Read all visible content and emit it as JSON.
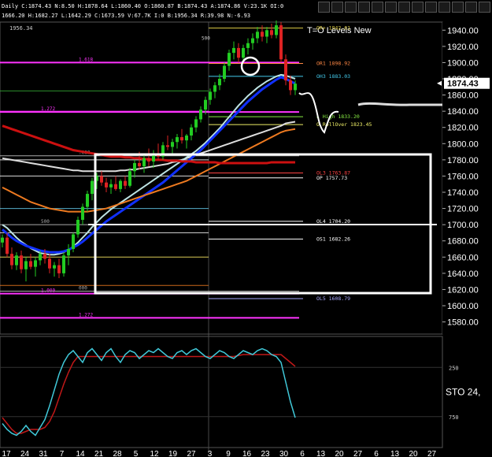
{
  "header": {
    "line1": "Daily  C:1874.43  N:8.50  H:1878.64  L:1860.40  O:1860.87  B:1874.43  A:1874.86  V:23.1K  OI:0",
    "line2": "1666.20  H:1682.27  L:1642.29  C:1673.59  V:67.7K  I:0  B:1956.34  R:39.98  N:-6.93",
    "line3": "1956.34"
  },
  "window_controls": [
    "icon-dollar",
    "icon-expand",
    "icon-pen",
    "icon-crosshair",
    "icon-link",
    "icon-page",
    "icon-calendar",
    "icon-tools",
    "icon-grid",
    "icon-arrows",
    "icon-bars",
    "icon-reset",
    "icon-close"
  ],
  "colors": {
    "background": "#000000",
    "candle_up": "#22cc22",
    "candle_down": "#dd2222",
    "ma_white": "#dddddd",
    "ma_cyan": "#bde3e3",
    "ma_blue": "#1030ff",
    "ma_orange": "#ee7a20",
    "ma_red": "#cc1010",
    "fib_line": "#ff33ff",
    "stoch_k": "#40c8d8",
    "stoch_d": "#c01818",
    "annotation": "#ffffff"
  },
  "chart_data": {
    "type": "candlestick",
    "title": "T=O Levels New",
    "timeframe": "Daily",
    "last_price": "1874.43",
    "ylim": [
      1565,
      1950
    ],
    "y_ticks": [
      1580,
      1600,
      1620,
      1640,
      1660,
      1680,
      1700,
      1720,
      1740,
      1760,
      1780,
      1800,
      1820,
      1840,
      1860,
      1880,
      1900,
      1920,
      1940
    ],
    "y_tick_labels": [
      "1580.00",
      "1600.00",
      "1620.00",
      "1640.00",
      "1660.00",
      "1680.00",
      "1700.00",
      "1720.00",
      "1740.00",
      "1760.00",
      "1780.00",
      "1800.00",
      "1820.00",
      "1840.00",
      "1860.00",
      "1880.00",
      "1900.00",
      "1920.00",
      "1940.00"
    ],
    "x_tick_labels": [
      "17",
      "24",
      "31",
      "7",
      "14",
      "21",
      "28",
      "5",
      "12",
      "19",
      "27",
      "3",
      "9",
      "16",
      "23",
      "30",
      "6",
      "13",
      "20",
      "27",
      "6",
      "13",
      "20",
      "27"
    ],
    "candles": [
      [
        1678,
        1688,
        1672,
        1684
      ],
      [
        1684,
        1690,
        1660,
        1664
      ],
      [
        1664,
        1672,
        1645,
        1650
      ],
      [
        1650,
        1666,
        1644,
        1662
      ],
      [
        1662,
        1668,
        1640,
        1645
      ],
      [
        1645,
        1660,
        1630,
        1655
      ],
      [
        1655,
        1664,
        1645,
        1648
      ],
      [
        1648,
        1660,
        1636,
        1656
      ],
      [
        1656,
        1668,
        1650,
        1664
      ],
      [
        1664,
        1670,
        1652,
        1658
      ],
      [
        1658,
        1664,
        1640,
        1646
      ],
      [
        1646,
        1654,
        1636,
        1650
      ],
      [
        1650,
        1658,
        1634,
        1640
      ],
      [
        1640,
        1666,
        1636,
        1662
      ],
      [
        1662,
        1676,
        1650,
        1670
      ],
      [
        1670,
        1690,
        1666,
        1688
      ],
      [
        1688,
        1710,
        1684,
        1706
      ],
      [
        1706,
        1726,
        1700,
        1722
      ],
      [
        1722,
        1742,
        1716,
        1738
      ],
      [
        1738,
        1758,
        1730,
        1754
      ],
      [
        1754,
        1764,
        1744,
        1760
      ],
      [
        1760,
        1766,
        1748,
        1752
      ],
      [
        1752,
        1758,
        1740,
        1746
      ],
      [
        1746,
        1756,
        1738,
        1750
      ],
      [
        1750,
        1760,
        1742,
        1744
      ],
      [
        1744,
        1756,
        1740,
        1754
      ],
      [
        1754,
        1760,
        1744,
        1748
      ],
      [
        1748,
        1770,
        1746,
        1766
      ],
      [
        1766,
        1780,
        1758,
        1776
      ],
      [
        1776,
        1790,
        1768,
        1772
      ],
      [
        1772,
        1786,
        1764,
        1782
      ],
      [
        1782,
        1794,
        1772,
        1778
      ],
      [
        1778,
        1792,
        1770,
        1788
      ],
      [
        1788,
        1800,
        1780,
        1784
      ],
      [
        1784,
        1802,
        1780,
        1798
      ],
      [
        1798,
        1810,
        1792,
        1796
      ],
      [
        1796,
        1806,
        1786,
        1802
      ],
      [
        1802,
        1812,
        1794,
        1808
      ],
      [
        1808,
        1818,
        1800,
        1804
      ],
      [
        1804,
        1812,
        1794,
        1810
      ],
      [
        1810,
        1824,
        1804,
        1820
      ],
      [
        1820,
        1834,
        1814,
        1830
      ],
      [
        1830,
        1846,
        1826,
        1842
      ],
      [
        1842,
        1858,
        1836,
        1854
      ],
      [
        1854,
        1868,
        1848,
        1864
      ],
      [
        1864,
        1876,
        1856,
        1872
      ],
      [
        1872,
        1886,
        1866,
        1880
      ],
      [
        1880,
        1900,
        1876,
        1896
      ],
      [
        1896,
        1916,
        1890,
        1912
      ],
      [
        1912,
        1926,
        1904,
        1918
      ],
      [
        1918,
        1924,
        1900,
        1906
      ],
      [
        1906,
        1922,
        1900,
        1918
      ],
      [
        1918,
        1930,
        1910,
        1924
      ],
      [
        1924,
        1936,
        1916,
        1930
      ],
      [
        1930,
        1944,
        1924,
        1938
      ],
      [
        1938,
        1946,
        1926,
        1932
      ],
      [
        1932,
        1944,
        1924,
        1940
      ],
      [
        1940,
        1948,
        1930,
        1934
      ],
      [
        1934,
        1952,
        1930,
        1946
      ],
      [
        1946,
        1950,
        1900,
        1904
      ],
      [
        1904,
        1910,
        1872,
        1878
      ],
      [
        1878,
        1884,
        1860,
        1866
      ],
      [
        1866,
        1878,
        1860,
        1874
      ]
    ],
    "moving_averages": [
      {
        "name": "MA-white",
        "color": "#dddddd",
        "values": [
          1782,
          1781,
          1780,
          1779,
          1778,
          1777,
          1776,
          1775,
          1774,
          1773,
          1772,
          1771,
          1770,
          1769,
          1768,
          1767,
          1767,
          1766,
          1766,
          1766,
          1766,
          1766,
          1766,
          1766,
          1766,
          1767,
          1767,
          1768,
          1768,
          1769,
          1770,
          1771,
          1772,
          1773,
          1774,
          1775,
          1777,
          1778,
          1780,
          1782,
          1784,
          1786,
          1788,
          1790,
          1792,
          1794,
          1796,
          1798,
          1800,
          1802,
          1804,
          1806,
          1808,
          1810,
          1812,
          1814,
          1816,
          1818,
          1820,
          1822,
          1825,
          1826,
          1827
        ]
      },
      {
        "name": "MA-cyan",
        "color": "#bde3e3",
        "values": [
          1700,
          1696,
          1690,
          1684,
          1679,
          1675,
          1671,
          1668,
          1665,
          1664,
          1663,
          1663,
          1664,
          1666,
          1669,
          1673,
          1678,
          1684,
          1690,
          1697,
          1703,
          1709,
          1714,
          1719,
          1723,
          1727,
          1731,
          1735,
          1739,
          1743,
          1747,
          1751,
          1755,
          1759,
          1763,
          1767,
          1771,
          1775,
          1779,
          1783,
          1787,
          1791,
          1796,
          1801,
          1807,
          1813,
          1819,
          1826,
          1833,
          1840,
          1847,
          1853,
          1859,
          1864,
          1869,
          1873,
          1877,
          1880,
          1883,
          1885,
          1884,
          1882,
          1880
        ]
      },
      {
        "name": "MA-blue",
        "color": "#1030ff",
        "values": [
          1694,
          1689,
          1684,
          1680,
          1677,
          1674,
          1672,
          1670,
          1668,
          1667,
          1666,
          1666,
          1666,
          1667,
          1669,
          1672,
          1675,
          1679,
          1684,
          1689,
          1694,
          1699,
          1704,
          1708,
          1712,
          1716,
          1720,
          1724,
          1728,
          1732,
          1736,
          1740,
          1744,
          1748,
          1752,
          1757,
          1762,
          1767,
          1772,
          1777,
          1782,
          1787,
          1792,
          1798,
          1804,
          1810,
          1816,
          1822,
          1828,
          1834,
          1840,
          1846,
          1852,
          1857,
          1862,
          1867,
          1871,
          1875,
          1879,
          1882,
          1880,
          1877,
          1874
        ]
      },
      {
        "name": "MA-orange",
        "color": "#ee7a20",
        "values": [
          1746,
          1743,
          1740,
          1737,
          1734,
          1731,
          1728,
          1726,
          1724,
          1722,
          1720,
          1719,
          1718,
          1717,
          1716,
          1716,
          1716,
          1716,
          1716,
          1717,
          1718,
          1719,
          1720,
          1722,
          1724,
          1726,
          1728,
          1730,
          1732,
          1734,
          1736,
          1738,
          1740,
          1742,
          1744,
          1746,
          1748,
          1750,
          1752,
          1754,
          1757,
          1760,
          1763,
          1766,
          1769,
          1772,
          1775,
          1778,
          1781,
          1784,
          1787,
          1790,
          1793,
          1796,
          1799,
          1802,
          1805,
          1808,
          1811,
          1814,
          1816,
          1817,
          1818
        ]
      },
      {
        "name": "MA-red",
        "color": "#cc1010",
        "values": [
          1822,
          1820,
          1818,
          1816,
          1814,
          1812,
          1810,
          1808,
          1806,
          1804,
          1802,
          1800,
          1798,
          1796,
          1794,
          1792,
          1791,
          1790,
          1789,
          1788,
          1787,
          1786,
          1785,
          1784,
          1784,
          1784,
          1783,
          1783,
          1782,
          1782,
          1781,
          1781,
          1780,
          1780,
          1780,
          1779,
          1779,
          1779,
          1778,
          1778,
          1778,
          1777,
          1777,
          1777,
          1777,
          1777,
          1776,
          1776,
          1776,
          1776,
          1776,
          1776,
          1776,
          1776,
          1776,
          1776,
          1776,
          1777,
          1777,
          1777,
          1777,
          1777,
          1777
        ]
      }
    ],
    "level_lines": [
      {
        "label": "OR+ 1942.61",
        "value": 1942.61,
        "color": "#ddcc44"
      },
      {
        "label": "OR1 1898.92",
        "value": 1898.92,
        "color": "#ff8844"
      },
      {
        "label": "OH3 1883.03",
        "value": 1883.03,
        "color": "#44ccee"
      },
      {
        "label": "L High 1833.20",
        "value": 1833.2,
        "color": "#88ee44"
      },
      {
        "label": "O RollOver 1823.45",
        "value": 1823.45,
        "color": "#eeee66"
      },
      {
        "label": "OL3 1763.87",
        "value": 1763.87,
        "color": "#ff4444"
      },
      {
        "label": "OP 1757.73",
        "value": 1757.73,
        "color": "#ffffff"
      },
      {
        "label": "OL4 1704.20",
        "value": 1704.2,
        "color": "#ffffff"
      },
      {
        "label": "OS1 1682.26",
        "value": 1682.26,
        "color": "#ffffff"
      },
      {
        "label": "OL5 1608.79",
        "value": 1608.79,
        "color": "#aaaaff"
      }
    ],
    "fib_lines": [
      {
        "label": "1.618",
        "value": 1900
      },
      {
        "label": "1.272",
        "value": 1839
      },
      {
        "label": ".000",
        "value": 1785
      },
      {
        "label": "500",
        "value": 1700
      },
      {
        "label": "000",
        "value": 1618
      },
      {
        "label": "1.000",
        "value": 1615
      },
      {
        "label": "1.272",
        "value": 1585
      }
    ],
    "fib_small_label": "500",
    "stochastic": {
      "label": "STO",
      "value_label": "24,",
      "levels": [
        "250",
        "750"
      ],
      "k_values": [
        18,
        12,
        8,
        6,
        10,
        16,
        10,
        6,
        14,
        22,
        36,
        52,
        68,
        80,
        88,
        92,
        86,
        80,
        90,
        94,
        88,
        82,
        90,
        94,
        86,
        80,
        88,
        92,
        90,
        84,
        88,
        92,
        90,
        94,
        90,
        86,
        84,
        90,
        92,
        88,
        92,
        94,
        90,
        86,
        84,
        88,
        92,
        90,
        86,
        84,
        88,
        92,
        90,
        88,
        92,
        94,
        92,
        88,
        86,
        80,
        60,
        40,
        24
      ],
      "d_values": [
        24,
        18,
        12,
        8,
        8,
        10,
        12,
        12,
        12,
        14,
        20,
        30,
        44,
        58,
        70,
        80,
        86,
        86,
        86,
        86,
        86,
        86,
        86,
        86,
        86,
        86,
        86,
        86,
        86,
        86,
        86,
        86,
        86,
        86,
        86,
        86,
        86,
        86,
        86,
        86,
        86,
        86,
        86,
        86,
        86,
        86,
        86,
        86,
        86,
        86,
        87,
        88,
        88,
        88,
        88,
        88,
        88,
        88,
        88,
        88,
        84,
        80,
        76
      ]
    }
  }
}
